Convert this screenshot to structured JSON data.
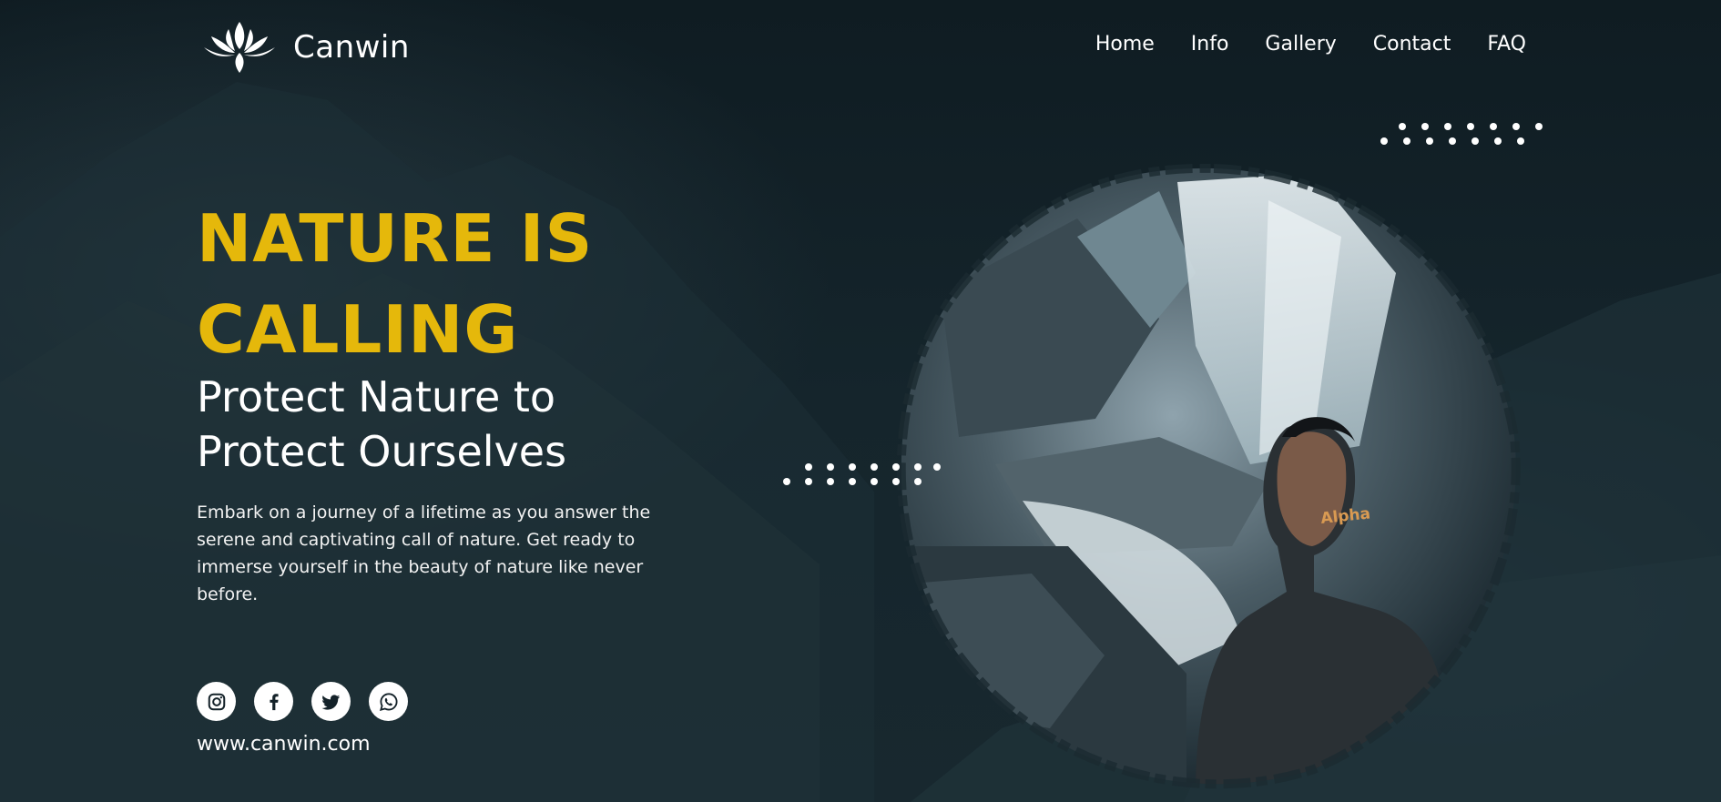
{
  "brand": {
    "name": "Canwin",
    "logo_icon": "lotus-icon"
  },
  "nav": {
    "items": [
      {
        "label": "Home"
      },
      {
        "label": "Info"
      },
      {
        "label": "Gallery"
      },
      {
        "label": "Contact"
      },
      {
        "label": "FAQ"
      }
    ]
  },
  "hero": {
    "headline_line1": "NATURE IS",
    "headline_line2": "CALLING",
    "subhead_line1": "Protect Nature to",
    "subhead_line2": "Protect Ourselves",
    "body": "Embark on a journey of a lifetime as you answer the serene and captivating call of nature. Get ready to immerse yourself in the beauty of nature like never before.",
    "photo_caption_text": "Alpha"
  },
  "socials": [
    {
      "icon": "instagram-icon"
    },
    {
      "icon": "facebook-icon"
    },
    {
      "icon": "twitter-icon"
    },
    {
      "icon": "whatsapp-icon"
    }
  ],
  "footer": {
    "website": "www.canwin.com"
  },
  "colors": {
    "accent": "#e5b80b",
    "background": "#142229",
    "text": "#ffffff"
  }
}
